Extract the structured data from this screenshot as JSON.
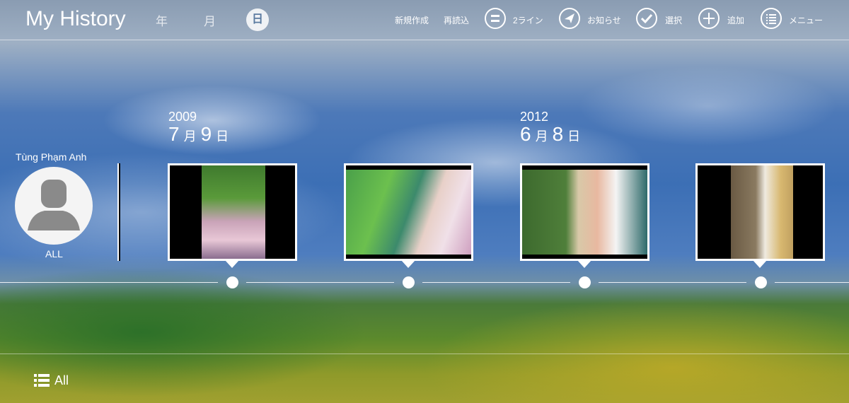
{
  "header": {
    "title": "My History",
    "scale": {
      "year": "年",
      "month": "月",
      "day": "日"
    },
    "commands": {
      "new": "新規作成",
      "reload": "再読込",
      "two_line": "2ライン",
      "notice": "お知らせ",
      "select": "選択",
      "add": "追加",
      "menu": "メニュー"
    }
  },
  "profile": {
    "name": "Tùng Phạm Anh",
    "filter": "ALL"
  },
  "groups": [
    {
      "year": "2009",
      "month": "7",
      "month_unit": "月",
      "day": "9",
      "day_unit": "日"
    },
    {
      "year": "2012",
      "month": "6",
      "month_unit": "月",
      "day": "8",
      "day_unit": "日"
    }
  ],
  "photos": [
    {
      "desc": "girl-in-pink-dress-flowers"
    },
    {
      "desc": "girl-among-lotus-leaves"
    },
    {
      "desc": "girl-in-white-ao-dai-building"
    },
    {
      "desc": "girl-in-white-ao-dai-tree"
    }
  ],
  "footer": {
    "all_label": "All"
  },
  "colors": {
    "accent": "#ffffff",
    "day_active_text": "#5a7aa0"
  },
  "icons": [
    "two-line-icon",
    "send-icon",
    "check-icon",
    "plus-icon",
    "list-icon",
    "user-avatar-icon"
  ]
}
